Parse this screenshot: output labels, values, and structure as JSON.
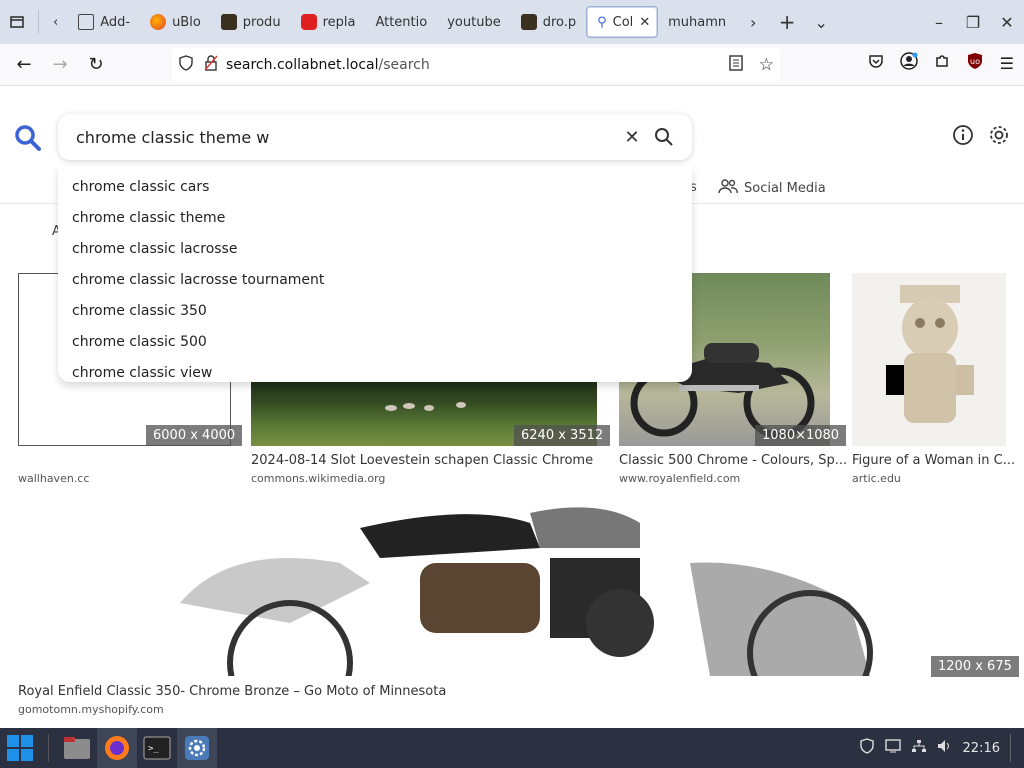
{
  "browser": {
    "tabs": [
      {
        "label": "",
        "icon": "back-icon"
      },
      {
        "label": "Add-",
        "icon": "puzzle-icon"
      },
      {
        "label": "uBlo",
        "icon": "firefox-icon"
      },
      {
        "label": "produ",
        "icon": "terminal-icon"
      },
      {
        "label": "repla",
        "icon": "youtube-icon"
      },
      {
        "label": "Attentio",
        "icon": ""
      },
      {
        "label": "youtube",
        "icon": ""
      },
      {
        "label": "dro.p",
        "icon": "terminal-icon"
      },
      {
        "label": "Col",
        "icon": "search-icon",
        "active": true
      },
      {
        "label": "muhamn",
        "icon": ""
      }
    ],
    "url_host": "search.collabnet.local",
    "url_path": "/search"
  },
  "search": {
    "value": "chrome classic theme w",
    "suggestions": [
      "chrome classic cars",
      "chrome classic theme",
      "chrome classic lacrosse",
      "chrome classic lacrosse tournament",
      "chrome classic 350",
      "chrome classic 500",
      "chrome classic view"
    ],
    "category_social": "Social Media",
    "category_partial": "es",
    "partial_letter": "A"
  },
  "results": [
    {
      "dims": "6000 x 4000",
      "title": "",
      "source": "wallhaven.cc"
    },
    {
      "dims": "6240 x 3512",
      "title": "2024-08-14 Slot Loevestein schapen Classic Chrome",
      "source": "commons.wikimedia.org"
    },
    {
      "dims": "1080×1080",
      "title": "Classic 500 Chrome - Colours, Sp...",
      "source": "www.royalenfield.com"
    },
    {
      "dims": "",
      "title": "Figure of a Woman in C...",
      "source": "artic.edu"
    },
    {
      "dims": "1200 x 675",
      "title": "Royal Enfield Classic 350- Chrome Bronze – Go Moto of Minnesota",
      "source": "gomotomn.myshopify.com"
    }
  ],
  "taskbar": {
    "time": "22:16"
  },
  "colors": {
    "accent": "#3b63d6",
    "tabbar": "#dbe1ec",
    "taskbar": "#2b3140"
  }
}
